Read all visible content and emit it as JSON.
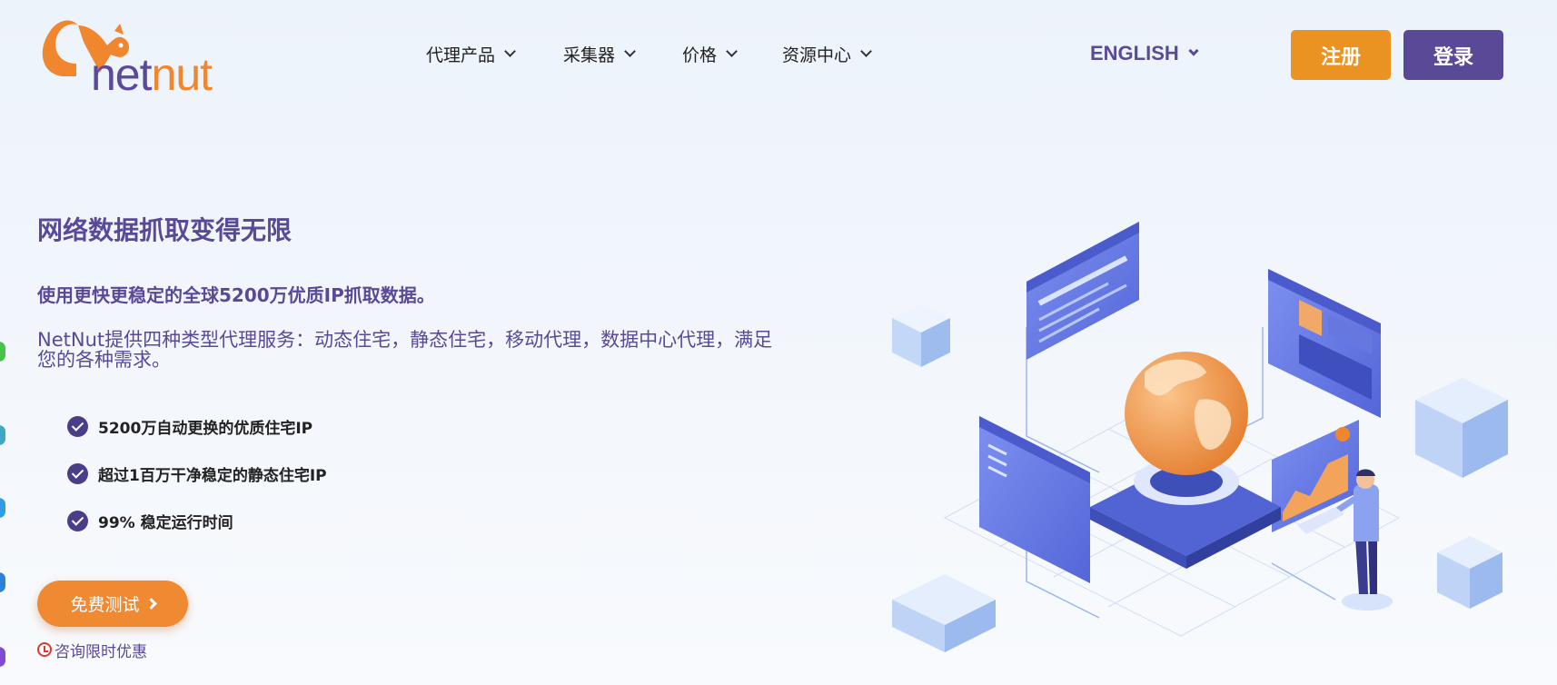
{
  "header": {
    "logo_text_net": "net",
    "logo_text_nut": "nut",
    "nav": [
      {
        "label": "代理产品"
      },
      {
        "label": "采集器"
      },
      {
        "label": "价格"
      },
      {
        "label": "资源中心"
      }
    ],
    "language": "ENGLISH",
    "register_label": "注册",
    "login_label": "登录"
  },
  "hero": {
    "title": "网络数据抓取变得无限",
    "subtitle": "使用更快更稳定的全球5200万优质IP抓取数据。",
    "description": "NetNut提供四种类型代理服务：动态住宅，静态住宅，移动代理，数据中心代理，满足您的各种需求。",
    "features": [
      "5200万自动更换的优质住宅IP",
      "超过1百万干净稳定的静态住宅IP",
      "99% 稳定运行时间"
    ],
    "trial_button": "免费测试",
    "promo_text": "咨询限时优惠"
  },
  "colors": {
    "brand_purple": "#5a4997",
    "brand_orange": "#ea9322",
    "trial_orange": "#f08a32"
  },
  "icons": [
    "squirrel-logo-icon",
    "chevron-down-icon",
    "check-circle-icon",
    "chevron-right-icon",
    "alarm-clock-icon"
  ]
}
